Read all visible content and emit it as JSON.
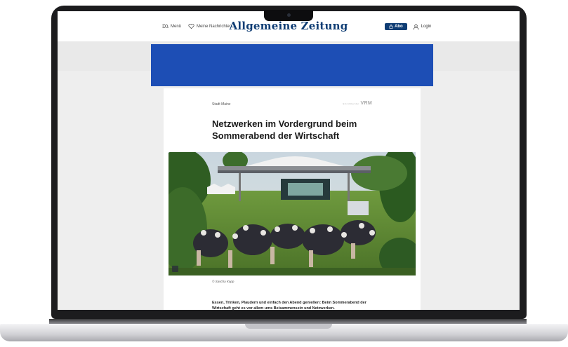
{
  "header": {
    "menu_label": "Menü",
    "news_label": "Meine Nachrichten",
    "logo": "Allgemeine Zeitung",
    "abo_label": "Abo",
    "login_label": "Login"
  },
  "article": {
    "kicker": "Stadt Mainz",
    "brand_small": "Ein Artikel der",
    "brand": "VRM",
    "headline": "Netzwerken im Vordergrund beim Sommerabend der Wirtschaft",
    "photo_credit": "© Sascha Kopp",
    "teaser": "Essen, Trinken, Plaudern und einfach den Abend genießen: Beim Sommerabend der Wirtschaft geht es vor allem ums Beisammensein und Netzwerken."
  },
  "colors": {
    "brand_blue": "#0f3d74",
    "ad_blue": "#1d4eb5"
  },
  "icons": {
    "menu": "search-menu-icon",
    "news": "heart-icon",
    "abo": "bag-icon",
    "login": "user-icon"
  }
}
